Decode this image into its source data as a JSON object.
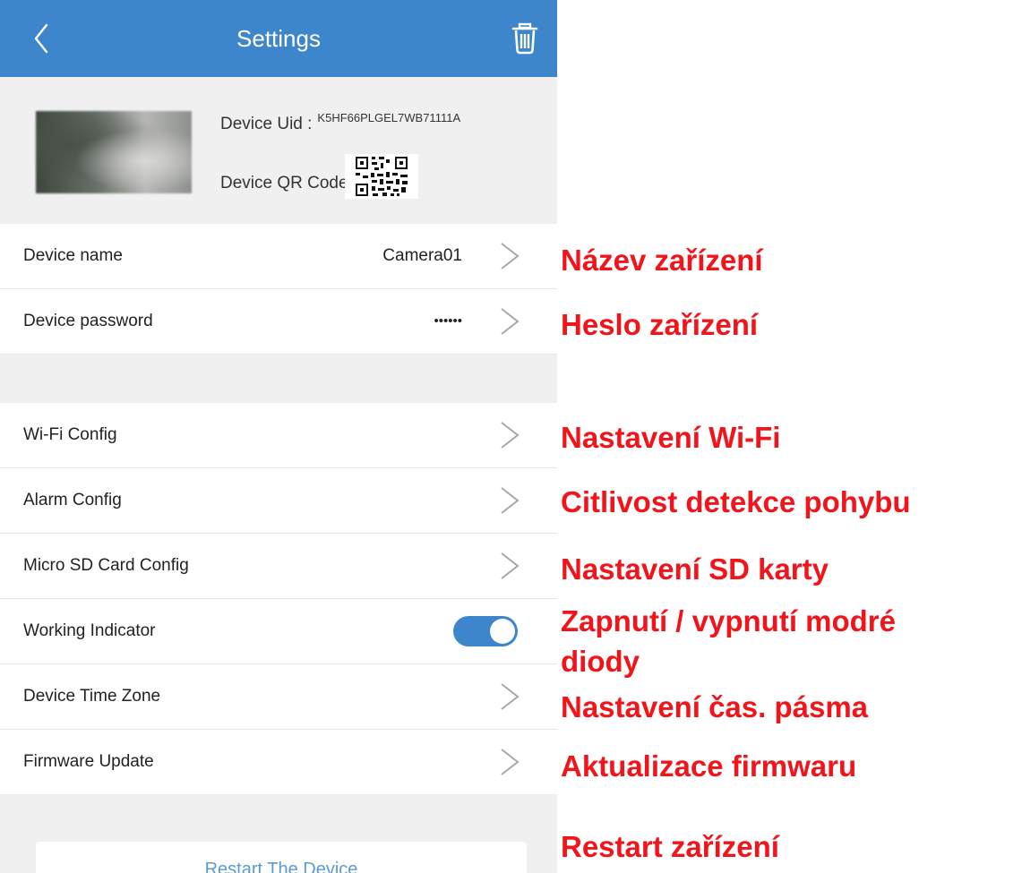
{
  "header": {
    "title": "Settings",
    "back_icon": "chevron-left-icon",
    "delete_icon": "trash-icon",
    "background": "#3e86cc"
  },
  "device": {
    "uid_label": "Device Uid :",
    "uid_value": "K5HF66PLGEL7WB71111A",
    "qr_label": "Device QR Code:"
  },
  "settings": {
    "device_name": {
      "label": "Device name",
      "value": "Camera01"
    },
    "device_password": {
      "label": "Device password",
      "value": "••••••"
    },
    "wifi_config": {
      "label": "Wi-Fi Config"
    },
    "alarm_config": {
      "label": "Alarm Config"
    },
    "sd_card_config": {
      "label": "Micro SD Card Config"
    },
    "working_indicator": {
      "label": "Working Indicator",
      "enabled": true
    },
    "time_zone": {
      "label": "Device Time Zone"
    },
    "firmware_update": {
      "label": "Firmware Update"
    }
  },
  "restart": {
    "label": "Restart The Device"
  },
  "annotations": {
    "device_name": "Název zařízení",
    "device_password": "Heslo zařízení",
    "wifi": "Nastavení Wi-Fi",
    "alarm": "Citlivost detekce pohybu",
    "sd_card": "Nastavení SD karty",
    "indicator_line1": "Zapnutí / vypnutí modré",
    "indicator_line2": "diody",
    "time_zone": "Nastavení čas. pásma",
    "firmware": "Aktualizace firmwaru",
    "restart": "Restart zařízení",
    "color": "#f2141b"
  }
}
